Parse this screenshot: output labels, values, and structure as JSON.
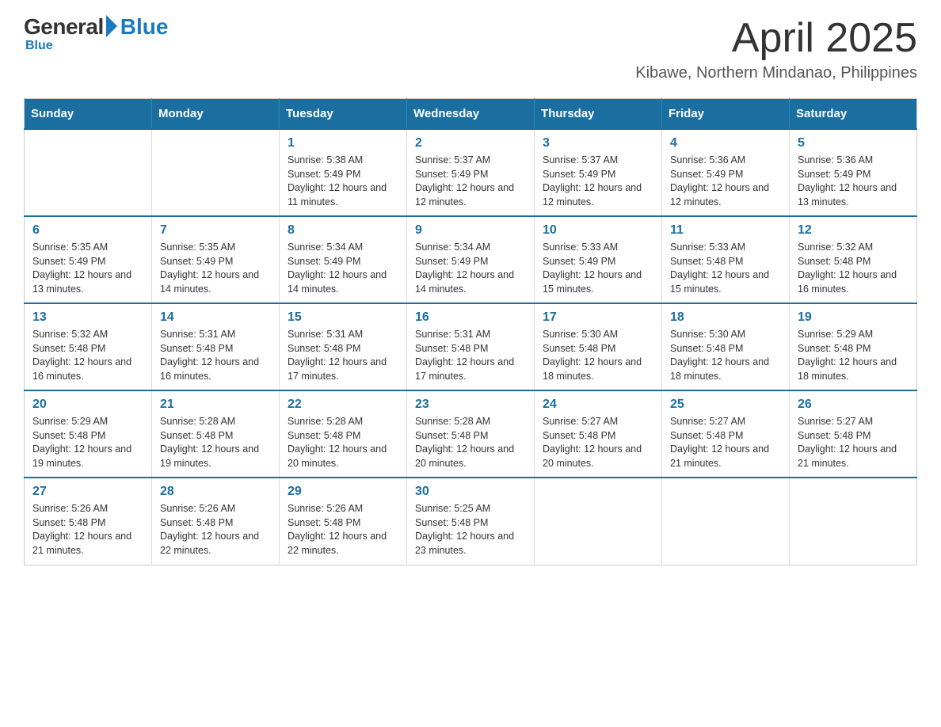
{
  "logo": {
    "general": "General",
    "blue": "Blue"
  },
  "header": {
    "title": "April 2025",
    "subtitle": "Kibawe, Northern Mindanao, Philippines"
  },
  "days_of_week": [
    "Sunday",
    "Monday",
    "Tuesday",
    "Wednesday",
    "Thursday",
    "Friday",
    "Saturday"
  ],
  "weeks": [
    {
      "days": [
        {
          "day": null
        },
        {
          "day": null
        },
        {
          "day": "1",
          "sunrise": "5:38 AM",
          "sunset": "5:49 PM",
          "daylight": "12 hours and 11 minutes."
        },
        {
          "day": "2",
          "sunrise": "5:37 AM",
          "sunset": "5:49 PM",
          "daylight": "12 hours and 12 minutes."
        },
        {
          "day": "3",
          "sunrise": "5:37 AM",
          "sunset": "5:49 PM",
          "daylight": "12 hours and 12 minutes."
        },
        {
          "day": "4",
          "sunrise": "5:36 AM",
          "sunset": "5:49 PM",
          "daylight": "12 hours and 12 minutes."
        },
        {
          "day": "5",
          "sunrise": "5:36 AM",
          "sunset": "5:49 PM",
          "daylight": "12 hours and 13 minutes."
        }
      ]
    },
    {
      "days": [
        {
          "day": "6",
          "sunrise": "5:35 AM",
          "sunset": "5:49 PM",
          "daylight": "12 hours and 13 minutes."
        },
        {
          "day": "7",
          "sunrise": "5:35 AM",
          "sunset": "5:49 PM",
          "daylight": "12 hours and 14 minutes."
        },
        {
          "day": "8",
          "sunrise": "5:34 AM",
          "sunset": "5:49 PM",
          "daylight": "12 hours and 14 minutes."
        },
        {
          "day": "9",
          "sunrise": "5:34 AM",
          "sunset": "5:49 PM",
          "daylight": "12 hours and 14 minutes."
        },
        {
          "day": "10",
          "sunrise": "5:33 AM",
          "sunset": "5:49 PM",
          "daylight": "12 hours and 15 minutes."
        },
        {
          "day": "11",
          "sunrise": "5:33 AM",
          "sunset": "5:48 PM",
          "daylight": "12 hours and 15 minutes."
        },
        {
          "day": "12",
          "sunrise": "5:32 AM",
          "sunset": "5:48 PM",
          "daylight": "12 hours and 16 minutes."
        }
      ]
    },
    {
      "days": [
        {
          "day": "13",
          "sunrise": "5:32 AM",
          "sunset": "5:48 PM",
          "daylight": "12 hours and 16 minutes."
        },
        {
          "day": "14",
          "sunrise": "5:31 AM",
          "sunset": "5:48 PM",
          "daylight": "12 hours and 16 minutes."
        },
        {
          "day": "15",
          "sunrise": "5:31 AM",
          "sunset": "5:48 PM",
          "daylight": "12 hours and 17 minutes."
        },
        {
          "day": "16",
          "sunrise": "5:31 AM",
          "sunset": "5:48 PM",
          "daylight": "12 hours and 17 minutes."
        },
        {
          "day": "17",
          "sunrise": "5:30 AM",
          "sunset": "5:48 PM",
          "daylight": "12 hours and 18 minutes."
        },
        {
          "day": "18",
          "sunrise": "5:30 AM",
          "sunset": "5:48 PM",
          "daylight": "12 hours and 18 minutes."
        },
        {
          "day": "19",
          "sunrise": "5:29 AM",
          "sunset": "5:48 PM",
          "daylight": "12 hours and 18 minutes."
        }
      ]
    },
    {
      "days": [
        {
          "day": "20",
          "sunrise": "5:29 AM",
          "sunset": "5:48 PM",
          "daylight": "12 hours and 19 minutes."
        },
        {
          "day": "21",
          "sunrise": "5:28 AM",
          "sunset": "5:48 PM",
          "daylight": "12 hours and 19 minutes."
        },
        {
          "day": "22",
          "sunrise": "5:28 AM",
          "sunset": "5:48 PM",
          "daylight": "12 hours and 20 minutes."
        },
        {
          "day": "23",
          "sunrise": "5:28 AM",
          "sunset": "5:48 PM",
          "daylight": "12 hours and 20 minutes."
        },
        {
          "day": "24",
          "sunrise": "5:27 AM",
          "sunset": "5:48 PM",
          "daylight": "12 hours and 20 minutes."
        },
        {
          "day": "25",
          "sunrise": "5:27 AM",
          "sunset": "5:48 PM",
          "daylight": "12 hours and 21 minutes."
        },
        {
          "day": "26",
          "sunrise": "5:27 AM",
          "sunset": "5:48 PM",
          "daylight": "12 hours and 21 minutes."
        }
      ]
    },
    {
      "days": [
        {
          "day": "27",
          "sunrise": "5:26 AM",
          "sunset": "5:48 PM",
          "daylight": "12 hours and 21 minutes."
        },
        {
          "day": "28",
          "sunrise": "5:26 AM",
          "sunset": "5:48 PM",
          "daylight": "12 hours and 22 minutes."
        },
        {
          "day": "29",
          "sunrise": "5:26 AM",
          "sunset": "5:48 PM",
          "daylight": "12 hours and 22 minutes."
        },
        {
          "day": "30",
          "sunrise": "5:25 AM",
          "sunset": "5:48 PM",
          "daylight": "12 hours and 23 minutes."
        },
        {
          "day": null
        },
        {
          "day": null
        },
        {
          "day": null
        }
      ]
    }
  ]
}
